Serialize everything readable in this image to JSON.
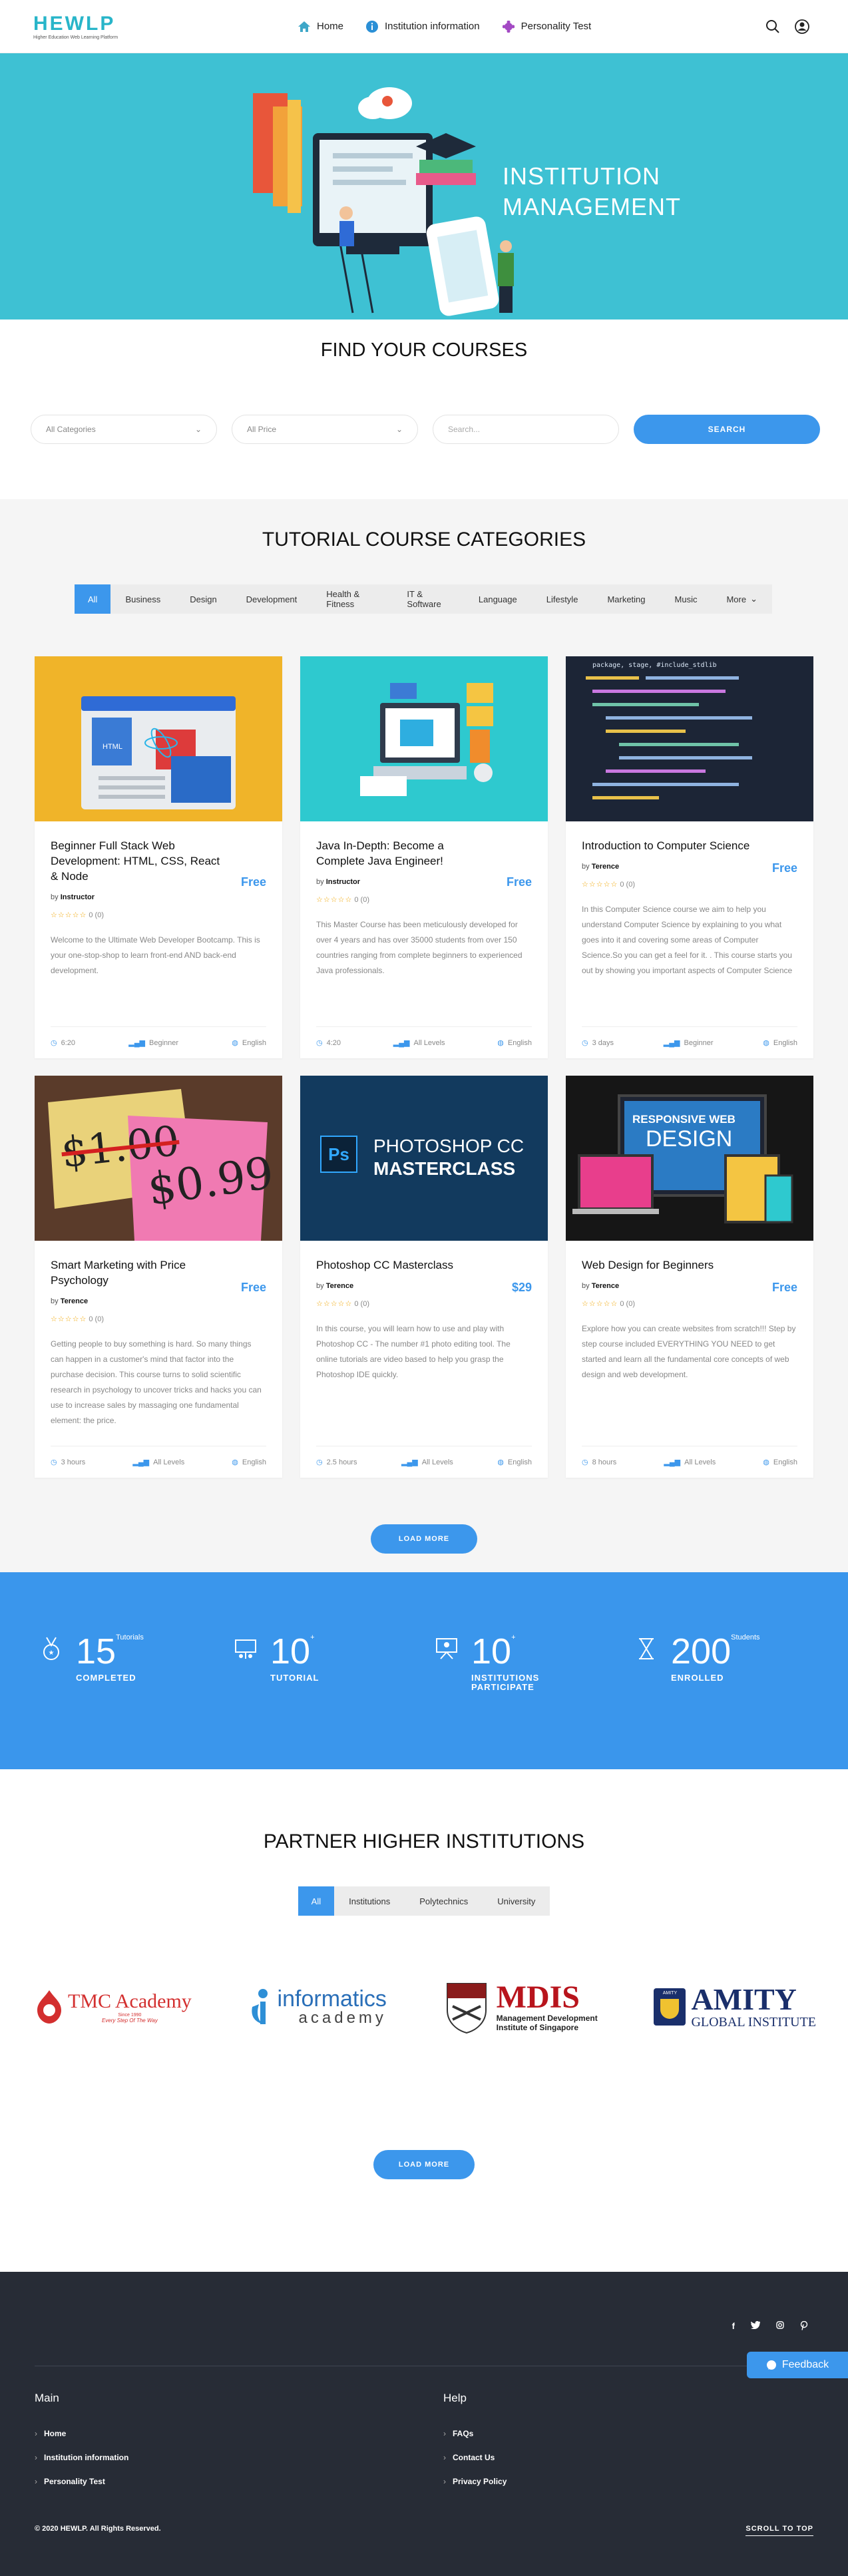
{
  "header": {
    "logo": "HEWLP",
    "logo_tagline": "Higher Education Web Learning Platform",
    "nav": [
      {
        "label": "Home",
        "icon": "home-icon"
      },
      {
        "label": "Institution information",
        "icon": "info-icon"
      },
      {
        "label": "Personality Test",
        "icon": "puzzle-icon"
      }
    ]
  },
  "hero": {
    "title_line1": "INSTITUTION",
    "title_line2": "MANAGEMENT"
  },
  "find": {
    "title": "FIND YOUR COURSES",
    "categories_select": "All Categories",
    "price_select": "All Price",
    "search_placeholder": "Search...",
    "search_button": "SEARCH"
  },
  "tutorial": {
    "title": "TUTORIAL COURSE CATEGORIES",
    "tabs": [
      "All",
      "Business",
      "Design",
      "Development",
      "Health & Fitness",
      "IT & Software",
      "Language",
      "Lifestyle",
      "Marketing",
      "Music",
      "More"
    ],
    "load_more": "LOAD MORE",
    "courses": [
      {
        "title": "Beginner Full Stack Web Development: HTML, CSS, React & Node",
        "price": "Free",
        "by": "by",
        "author": "Instructor",
        "rating": "0 (0)",
        "desc": "Welcome to the Ultimate Web Developer Bootcamp. This is your one-stop-shop to learn front-end AND back-end development.",
        "duration": "6:20",
        "level": "Beginner",
        "lang": "English"
      },
      {
        "title": "Java In-Depth: Become a Complete Java Engineer!",
        "price": "Free",
        "by": "by",
        "author": "Instructor",
        "rating": "0 (0)",
        "desc": "This Master Course has been meticulously developed for over 4 years and has over 35000 students from over 150 countries ranging from complete beginners to experienced Java professionals.",
        "duration": "4:20",
        "level": "All Levels",
        "lang": "English"
      },
      {
        "title": "Introduction to Computer Science",
        "price": "Free",
        "by": "by",
        "author": "Terence",
        "rating": "0 (0)",
        "desc": "In this Computer Science course we aim to help you understand Computer Science by explaining to you what goes into it and covering some areas of Computer Science.So you can get a feel for it. . This course starts you out by showing you important aspects of Computer Science",
        "duration": "3 days",
        "level": "Beginner",
        "lang": "English"
      },
      {
        "title": "Smart Marketing with Price Psychology",
        "price": "Free",
        "by": "by",
        "author": "Terence",
        "rating": "0 (0)",
        "desc": "Getting people to buy something is hard. So many things can happen in a customer's mind that factor into the purchase decision. This course turns to solid scientific research in psychology to uncover tricks and hacks you can use to increase sales by massaging one fundamental element: the price.",
        "duration": "3 hours",
        "level": "All Levels",
        "lang": "English"
      },
      {
        "title": "Photoshop CC Masterclass",
        "price": "$29",
        "by": "by",
        "author": "Terence",
        "rating": "0 (0)",
        "desc": "In this course, you will learn how to use and play with Photoshop CC - The number #1 photo editing tool. The online tutorials are video based to help you grasp the Photoshop IDE quickly.",
        "duration": "2.5 hours",
        "level": "All Levels",
        "lang": "English"
      },
      {
        "title": "Web Design for Beginners",
        "price": "Free",
        "by": "by",
        "author": "Terence",
        "rating": "0 (0)",
        "desc": "Explore how you can create websites from scratch!!! Step by step course included EVERYTHING YOU NEED to get started and learn all the fundamental core concepts of web design and web development.",
        "duration": "8 hours",
        "level": "All Levels",
        "lang": "English"
      }
    ],
    "img_texts": {
      "html": "HTML",
      "ps_title": "PHOTOSHOP CC",
      "ps_sub": "MASTERCLASS",
      "ps_logo": "Ps",
      "rwd1": "RESPONSIVE WEB",
      "rwd2": "DESIGN",
      "price1": "$1.00",
      "price2": "$0.99",
      "code": "package, stage, #include_stdlib"
    }
  },
  "stats": [
    {
      "num": "15",
      "sup": "Tutorials",
      "label1": "COMPLETED",
      "label2": ""
    },
    {
      "num": "10",
      "sup": "+",
      "label1": "TUTORIAL",
      "label2": ""
    },
    {
      "num": "10",
      "sup": "+",
      "label1": "INSTITUTIONS",
      "label2": "PARTICIPATE"
    },
    {
      "num": "200",
      "sup": "Students",
      "label1": "ENROLLED",
      "label2": ""
    }
  ],
  "partners": {
    "title": "PARTNER HIGHER INSTITUTIONS",
    "tabs": [
      "All",
      "Institutions",
      "Polytechnics",
      "University"
    ],
    "load_more": "LOAD MORE",
    "logos": {
      "tmc": "TMC Academy",
      "tmc_sub": "Since 1990",
      "tmc_tag": "Every Step Of The Way",
      "inf1": "informatics",
      "inf2": "academy",
      "mdis": "MDIS",
      "mdis_sub1": "Management Development",
      "mdis_sub2": "Institute of Singapore",
      "amity1": "AMITY",
      "amity2": "GLOBAL INSTITUTE",
      "amity_badge": "AMITY"
    }
  },
  "footer": {
    "feedback": "Feedback",
    "main_title": "Main",
    "main_links": [
      "Home",
      "Institution information",
      "Personality Test"
    ],
    "help_title": "Help",
    "help_links": [
      "FAQs",
      "Contact Us",
      "Privacy Policy"
    ],
    "copyright": "© 2020 HEWLP. All Rights Reserved.",
    "scroll_top": "SCROLL TO TOP",
    "social": [
      "f",
      "t",
      "ig",
      "p"
    ]
  }
}
